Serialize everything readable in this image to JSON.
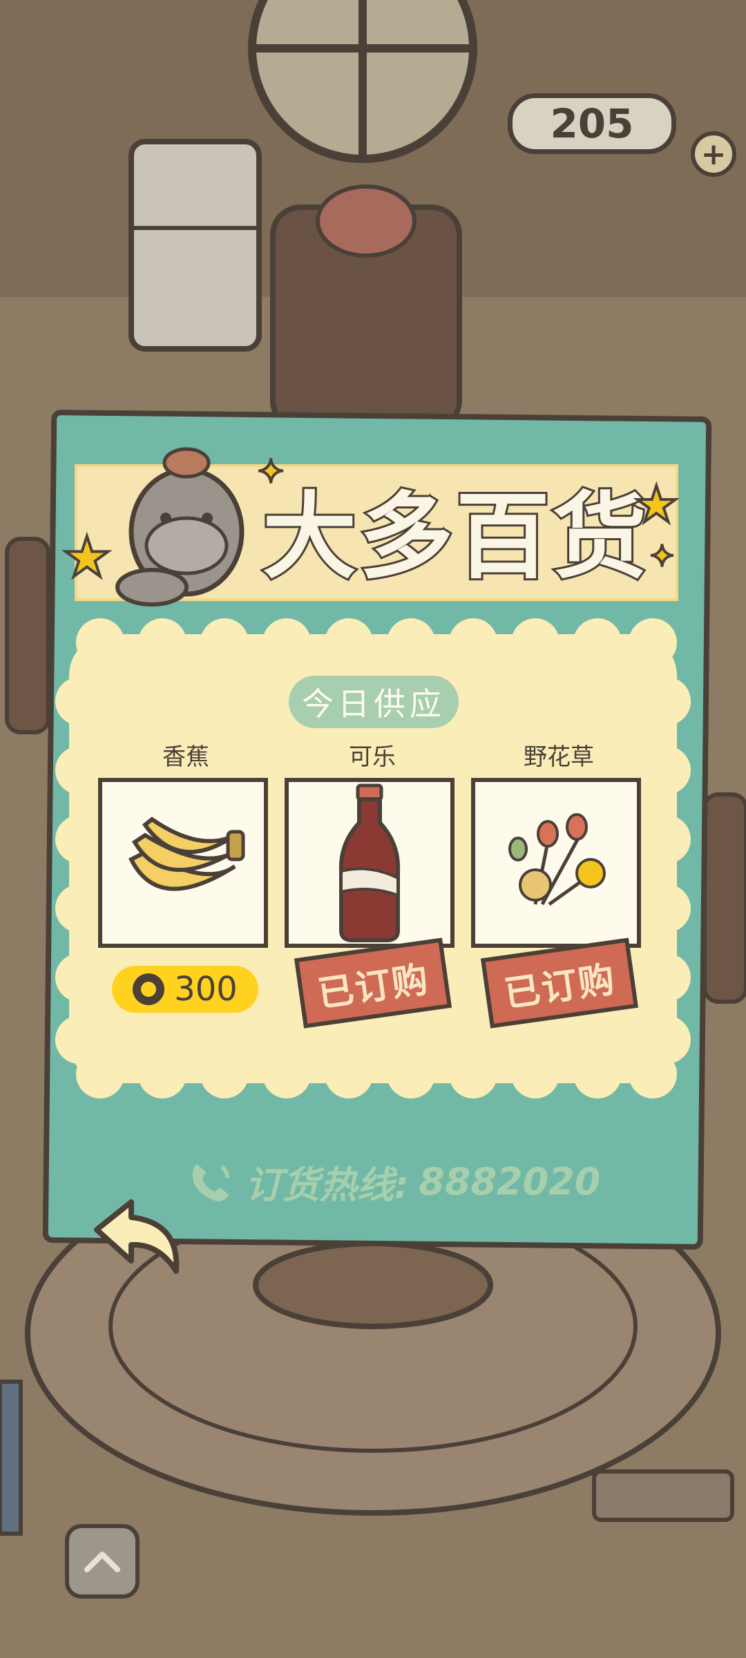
{
  "hud": {
    "counter_value": "205",
    "plus_label": "+"
  },
  "shop": {
    "title": "大多百货",
    "today_label": "今日供应",
    "items": [
      {
        "name": "香蕉",
        "price": "300",
        "status": ""
      },
      {
        "name": "可乐",
        "price": "",
        "status": "已订购"
      },
      {
        "name": "野花草",
        "price": "",
        "status": "已订购"
      }
    ],
    "hotline_label": "订货热线:",
    "hotline_number": "8882020"
  },
  "icons": [
    "phone-icon",
    "coin-icon",
    "back-arrow-icon",
    "up-chevron-icon"
  ],
  "colors": {
    "board": "#72b8a6",
    "panel": "#fbedb8",
    "price_badge": "#ffd21f",
    "ordered_tag": "#cf6a55",
    "outline": "#4a4038"
  }
}
